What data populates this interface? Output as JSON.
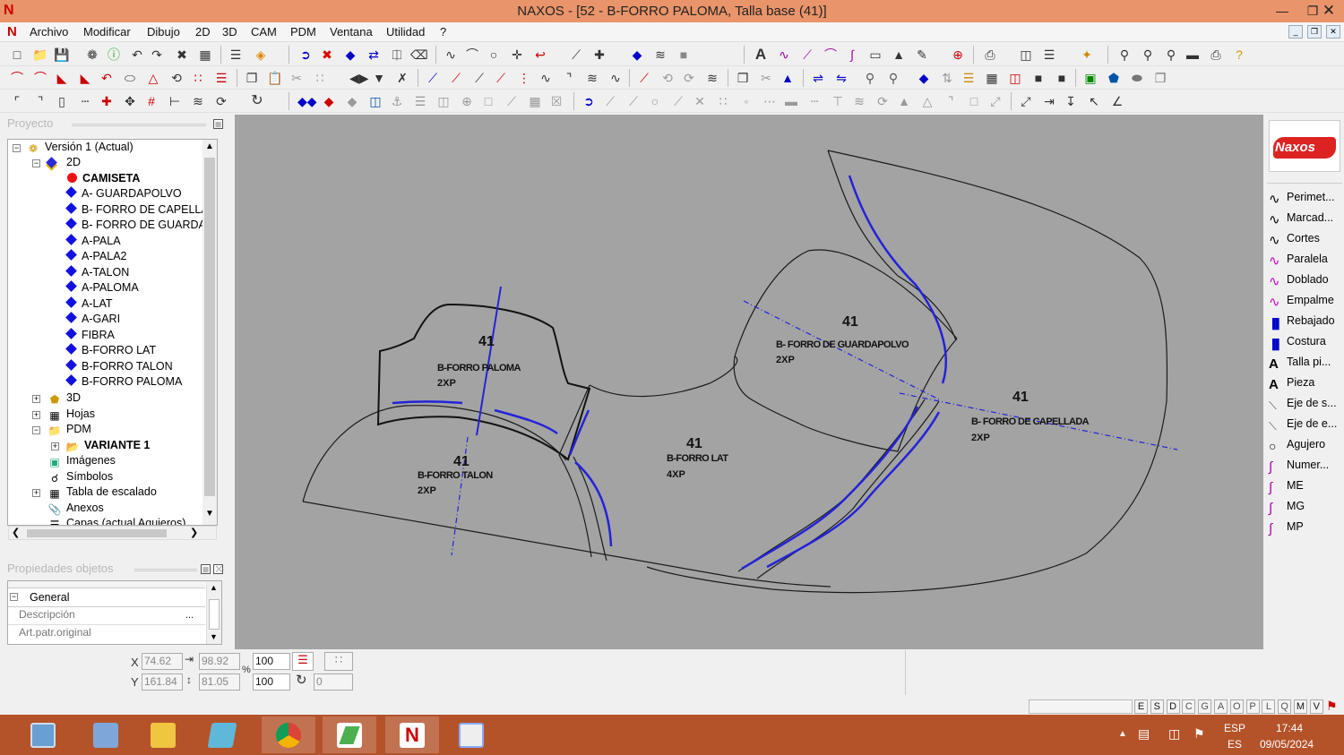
{
  "window": {
    "title": "NAXOS - [52 - B-FORRO PALOMA, Talla base (41)]",
    "controls": [
      "minimize-icon",
      "maximize-icon",
      "close-icon"
    ]
  },
  "menu": {
    "items": [
      "Archivo",
      "Modificar",
      "Dibujo",
      "2D",
      "3D",
      "CAM",
      "PDM",
      "Ventana",
      "Utilidad",
      "?"
    ]
  },
  "project_panel": {
    "title": "Proyecto",
    "tree": {
      "root": "Versión 1 (Actual)",
      "node_2d": "2D",
      "camiseta": "CAMISETA",
      "pieces": [
        "A- GUARDAPOLVO",
        "B- FORRO DE CAPELLA",
        "B- FORRO DE GUARDA",
        "A-PALA",
        "A-PALA2",
        "A-TALON",
        "A-PALOMA",
        "A-LAT",
        "A-GARI",
        "FIBRA",
        "B-FORRO LAT",
        "B-FORRO TALON",
        "B-FORRO PALOMA"
      ],
      "node_3d": "3D",
      "hojas": "Hojas",
      "pdm": "PDM",
      "variante": "VARIANTE 1",
      "imagenes": "Imágenes",
      "simbolos": "Símbolos",
      "tabla": "Tabla de escalado",
      "anexos": "Anexos",
      "capas": "Capas (actual Aguieros)"
    }
  },
  "properties_panel": {
    "title": "Propiedades objetos",
    "group": "General",
    "rows": [
      {
        "label": "Descripción",
        "value": "",
        "button": "..."
      },
      {
        "label": "Art.patr.original",
        "value": ""
      }
    ]
  },
  "canvas": {
    "pieces": [
      {
        "size": "41",
        "name": "B-FORRO PALOMA",
        "qty": "2XP"
      },
      {
        "size": "41",
        "name": "B-FORRO TALON",
        "qty": "2XP"
      },
      {
        "size": "41",
        "name": "B-FORRO LAT",
        "qty": "4XP"
      },
      {
        "size": "41",
        "name": "B- FORRO DE GUARDAPOLVO",
        "qty": "2XP"
      },
      {
        "size": "41",
        "name": "B- FORRO DE CAPELLADA",
        "qty": "2XP"
      }
    ]
  },
  "right_panel": {
    "logo_text": "Naxos",
    "tools": [
      "Perimet...",
      "Marcad...",
      "Cortes",
      "Paralela",
      "Doblado",
      "Empalme",
      "Rebajado",
      "Costura",
      "Talla pi...",
      "Pieza",
      "Eje de s...",
      "Eje de e...",
      "Agujero",
      "Numer...",
      "ME",
      "MG",
      "MP"
    ]
  },
  "coords": {
    "x_label": "X",
    "y_label": "Y",
    "x": "74.62",
    "y": "161.84",
    "width": "98.92",
    "height": "81.05",
    "scale_x": "100",
    "scale_y": "100",
    "percent": "%",
    "rotation": "0"
  },
  "status_letters": [
    "E",
    "S",
    "D",
    "C",
    "G",
    "A",
    "O",
    "P",
    "L",
    "Q",
    "M",
    "V"
  ],
  "taskbar": {
    "lang1": "ESP",
    "lang2": "ES",
    "time": "17:44",
    "date": "09/05/2024"
  },
  "colors": {
    "titlebar": "#e9946a",
    "canvas": "#a3a3a3",
    "taskbar": "#b4532a",
    "outline": "#1b1b1b",
    "grain_line": "#2323d8"
  }
}
